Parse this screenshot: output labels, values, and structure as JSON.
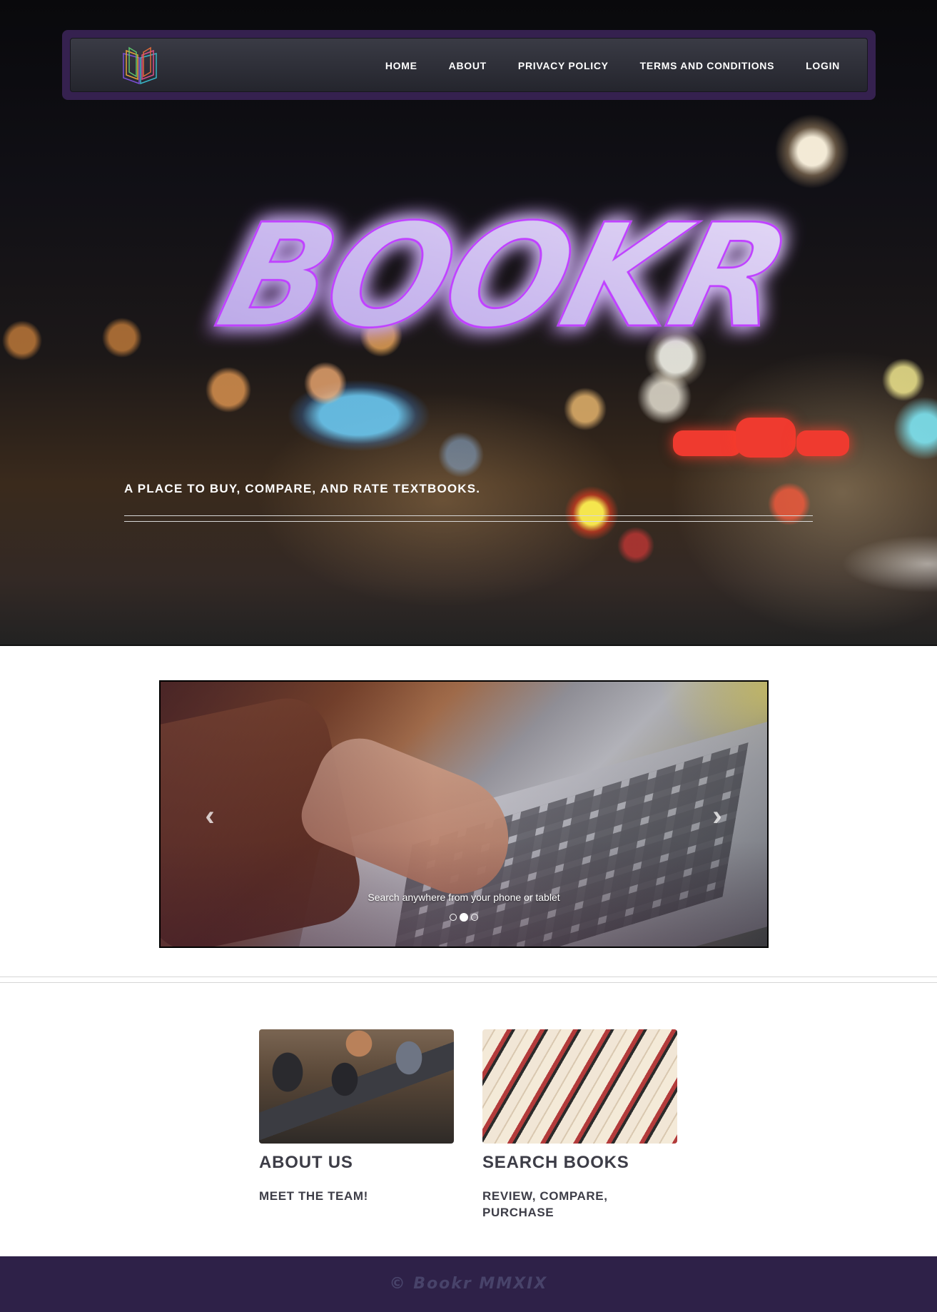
{
  "nav": {
    "items": [
      {
        "label": "HOME"
      },
      {
        "label": "ABOUT"
      },
      {
        "label": "PRIVACY POLICY"
      },
      {
        "label": "TERMS AND CONDITIONS"
      },
      {
        "label": "LOGIN"
      }
    ],
    "logo_icon": "open-book-icon",
    "accent": "#35214f"
  },
  "hero": {
    "brand": "BOOKR",
    "tagline": "A PLACE TO BUY, COMPARE, AND RATE TEXTBOOKS.",
    "brand_glow": "#c042ff"
  },
  "carousel": {
    "caption": "Search anywhere from your phone or tablet",
    "prev_icon": "chevron-left-icon",
    "next_icon": "chevron-right-icon",
    "prev_glyph": "‹",
    "next_glyph": "›",
    "slide_count": 3,
    "active_slide": 2
  },
  "features": [
    {
      "heading": "ABOUT US",
      "subheading": "MEET THE TEAM!",
      "image": "team-at-laptops"
    },
    {
      "heading": "SEARCH BOOKS",
      "subheading": "REVIEW, COMPARE, PURCHASE",
      "image": "stack-of-books"
    }
  ],
  "footer": {
    "copyright": "© Bookr MMXIX",
    "background": "#2e2148"
  }
}
